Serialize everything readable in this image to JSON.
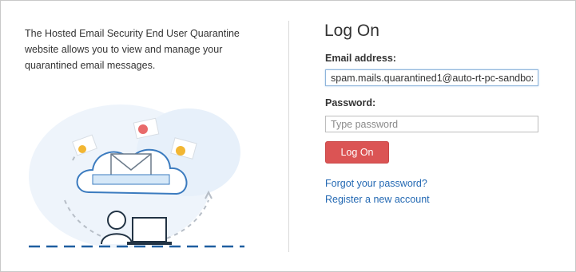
{
  "intro": {
    "line1": "The Hosted Email Security End User Quarantine",
    "line2": "website allows you to view and manage your",
    "line3": "quarantined email messages."
  },
  "logon": {
    "title": "Log On",
    "email_label": "Email address:",
    "email_value": "spam.mails.quarantined1@auto-rt-pc-sandbox.",
    "password_label": "Password:",
    "password_placeholder": "Type password",
    "button_label": "Log On",
    "forgot_link": "Forgot your password?",
    "register_link": "Register a new account"
  },
  "illustration": {
    "icons": [
      "cloud-icon",
      "envelope-icon",
      "user-icon",
      "laptop-icon",
      "paper-plane-icon"
    ]
  },
  "colors": {
    "button": "#db5454",
    "link": "#2469b3",
    "accent_blue": "#3b7bbf"
  }
}
